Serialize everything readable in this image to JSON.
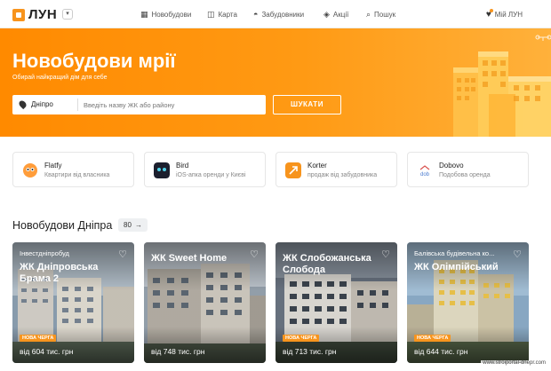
{
  "header": {
    "logo": "ЛУН",
    "nav": [
      {
        "label": "Новобудови",
        "icon": "building-icon"
      },
      {
        "label": "Карта",
        "icon": "map-icon"
      },
      {
        "label": "Забудовники",
        "icon": "helmet-icon"
      },
      {
        "label": "Акції",
        "icon": "tag-icon"
      },
      {
        "label": "Пошук",
        "icon": "search-icon"
      }
    ],
    "my_lun": "Мій ЛУН"
  },
  "hero": {
    "title": "Новобудови мрії",
    "subtitle": "Обирай найкращий дім для себе",
    "city": "Дніпро",
    "search_placeholder": "Введіть назву ЖК або району",
    "search_button": "ШУКАТИ"
  },
  "partners": [
    {
      "name": "Flatfy",
      "desc": "Квартири від власника",
      "color": "#ff9d3b"
    },
    {
      "name": "Bird",
      "desc": "iOS-апка оренди у Києві",
      "color": "#1c1f2e"
    },
    {
      "name": "Korter",
      "desc": "продаж від забудовника",
      "color": "#f7941d"
    },
    {
      "name": "Dobovo",
      "desc": "Подобова оренда",
      "color": "#4a7bd0"
    }
  ],
  "listings_section": {
    "title": "Новобудови Дніпра",
    "count": "80"
  },
  "listings": [
    {
      "developer": "Інвестдніпробуд",
      "title": "ЖК Дніпровська Брама 2",
      "badge": "НОВА ЧЕРГА",
      "price": "від 604 тис. грн"
    },
    {
      "developer": "",
      "title": "ЖК Sweet Home",
      "badge": "",
      "price": "від 748 тис. грн"
    },
    {
      "developer": "",
      "title": "ЖК Слобожанська Слобода",
      "badge": "НОВА ЧЕРГА",
      "price": "від 713 тис. грн"
    },
    {
      "developer": "Балівська будівельна ко...",
      "title": "ЖК Олімпійський",
      "badge": "НОВА ЧЕРГА",
      "price": "від 644 тис. грн"
    }
  ],
  "watermark": "www.stroiportal-dnepr.com"
}
